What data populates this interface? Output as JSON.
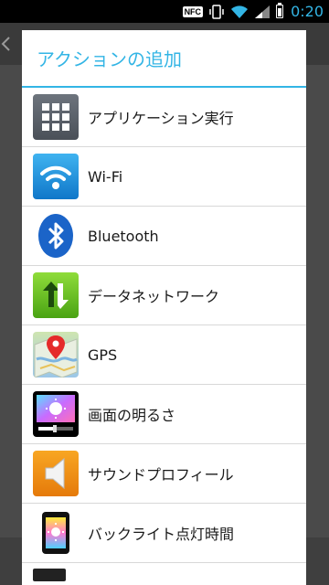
{
  "status_bar": {
    "nfc_label": "NFC",
    "time": "0:20",
    "icons": [
      "nfc-icon",
      "vibrate-icon",
      "wifi-icon",
      "signal-icon",
      "battery-icon"
    ]
  },
  "dialog": {
    "title": "アクションの追加",
    "accent_color": "#33b5e5",
    "items": [
      {
        "label": "アプリケーション実行",
        "icon": "apps-grid-icon"
      },
      {
        "label": "Wi-Fi",
        "icon": "wifi-icon"
      },
      {
        "label": "Bluetooth",
        "icon": "bluetooth-icon"
      },
      {
        "label": "データネットワーク",
        "icon": "data-network-icon"
      },
      {
        "label": "GPS",
        "icon": "gps-map-icon"
      },
      {
        "label": "画面の明るさ",
        "icon": "brightness-icon"
      },
      {
        "label": "サウンドプロフィール",
        "icon": "speaker-icon"
      },
      {
        "label": "バックライト点灯時間",
        "icon": "backlight-phone-icon"
      }
    ]
  }
}
